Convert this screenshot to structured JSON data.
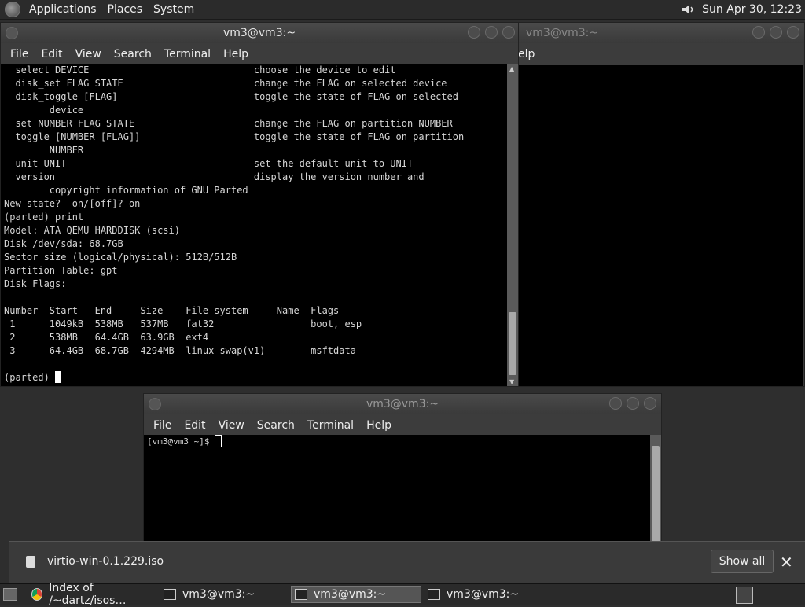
{
  "top_panel": {
    "menus": [
      "Applications",
      "Places",
      "System"
    ],
    "clock": "Sun Apr 30, 12:23"
  },
  "back_window": {
    "title": "vm3@vm3:~",
    "menu_fragment": "elp"
  },
  "main_window": {
    "title": "vm3@vm3:~",
    "menus": [
      "File",
      "Edit",
      "View",
      "Search",
      "Terminal",
      "Help"
    ],
    "terminal_lines": [
      "  select DEVICE                             choose the device to edit",
      "  disk_set FLAG STATE                       change the FLAG on selected device",
      "  disk_toggle [FLAG]                        toggle the state of FLAG on selected",
      "        device",
      "  set NUMBER FLAG STATE                     change the FLAG on partition NUMBER",
      "  toggle [NUMBER [FLAG]]                    toggle the state of FLAG on partition",
      "        NUMBER",
      "  unit UNIT                                 set the default unit to UNIT",
      "  version                                   display the version number and",
      "        copyright information of GNU Parted",
      "New state?  on/[off]? on",
      "(parted) print",
      "Model: ATA QEMU HARDDISK (scsi)",
      "Disk /dev/sda: 68.7GB",
      "Sector size (logical/physical): 512B/512B",
      "Partition Table: gpt",
      "Disk Flags:",
      "",
      "Number  Start   End     Size    File system     Name  Flags",
      " 1      1049kB  538MB   537MB   fat32                 boot, esp",
      " 2      538MB   64.4GB  63.9GB  ext4",
      " 3      64.4GB  68.7GB  4294MB  linux-swap(v1)        msftdata",
      ""
    ],
    "prompt": "(parted) "
  },
  "second_window": {
    "title": "vm3@vm3:~",
    "menus": [
      "File",
      "Edit",
      "View",
      "Search",
      "Terminal",
      "Help"
    ],
    "prompt": "[vm3@vm3 ~]$ "
  },
  "download_bar": {
    "filename": "virtio-win-0.1.229.iso",
    "show_all": "Show all",
    "close": "✕"
  },
  "taskbar": {
    "tasks": [
      {
        "label": "Index of /~dartz/isos…",
        "icon": "chrome-icon"
      },
      {
        "label": "vm3@vm3:~",
        "icon": "terminal-icon"
      },
      {
        "label": "vm3@vm3:~",
        "icon": "terminal-icon"
      },
      {
        "label": "vm3@vm3:~",
        "icon": "terminal-icon"
      }
    ]
  }
}
